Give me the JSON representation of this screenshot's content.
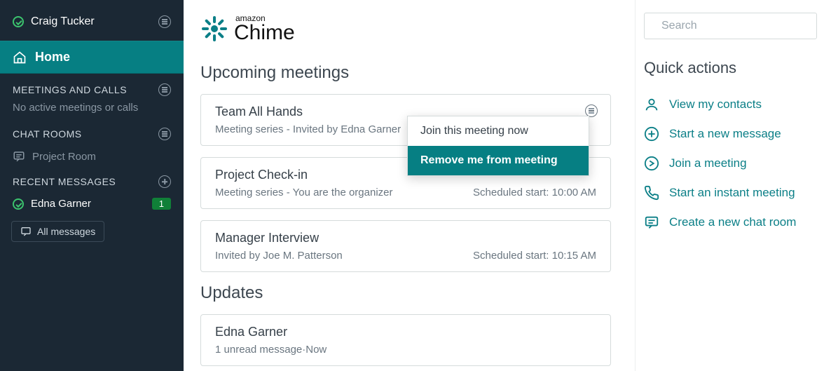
{
  "user": {
    "name": "Craig Tucker"
  },
  "nav": {
    "home": "Home"
  },
  "sections": {
    "meetings_header": "MEETINGS AND CALLS",
    "meetings_sub": "No active meetings or calls",
    "chatrooms_header": "CHAT ROOMS",
    "chatrooms_items": [
      "Project Room"
    ],
    "recent_header": "RECENT MESSAGES",
    "recent_items": [
      {
        "name": "Edna Garner",
        "badge": "1"
      }
    ],
    "all_messages_label": "All messages"
  },
  "brand": {
    "small": "amazon",
    "title": "Chime"
  },
  "upcoming": {
    "title": "Upcoming meetings",
    "items": [
      {
        "title": "Team All Hands",
        "sub_left": "Meeting series - Invited by Edna Garner",
        "sub_right": ""
      },
      {
        "title": "Project Check-in",
        "sub_left": "Meeting series - You are the organizer",
        "sub_right": "Scheduled start: 10:00 AM"
      },
      {
        "title": "Manager Interview",
        "sub_left": "Invited by Joe M. Patterson",
        "sub_right": "Scheduled start: 10:15 AM"
      }
    ]
  },
  "dropdown": {
    "items": [
      {
        "label": "Join this meeting now",
        "highlight": false
      },
      {
        "label": "Remove me from meeting",
        "highlight": true
      }
    ]
  },
  "updates": {
    "title": "Updates",
    "items": [
      {
        "title": "Edna Garner",
        "sub": "1 unread message·Now"
      }
    ]
  },
  "search": {
    "placeholder": "Search"
  },
  "quick_actions": {
    "title": "Quick actions",
    "items": [
      "View my contacts",
      "Start a new message",
      "Join a meeting",
      "Start an instant meeting",
      "Create a new chat room"
    ]
  }
}
